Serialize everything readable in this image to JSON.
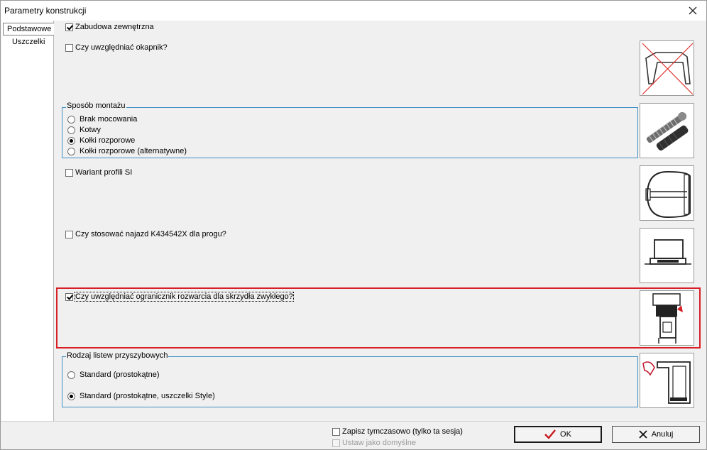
{
  "window": {
    "title": "Parametry konstrukcji"
  },
  "tabs": [
    {
      "label": "Podstawowe",
      "active": true
    },
    {
      "label": "Uszczelki",
      "active": false
    }
  ],
  "options": {
    "zabudowa": {
      "label": "Zabudowa zewnętrzna",
      "checked": true
    },
    "okapnik": {
      "label": "Czy uwzględniać okapnik?",
      "checked": false
    },
    "wariant": {
      "label": "Wariant profili SI",
      "checked": false
    },
    "najazd": {
      "label": "Czy stosować najazd K434542X dla progu?",
      "checked": false
    },
    "ogranicznik": {
      "label": "Czy uwzględniać ogranicznik rozwarcia dla skrzydła zwykłego?",
      "checked": true
    }
  },
  "montaz": {
    "title": "Sposób montażu",
    "items": [
      {
        "label": "Brak mocowania",
        "selected": false
      },
      {
        "label": "Kotwy",
        "selected": false
      },
      {
        "label": "Kołki rozporowe",
        "selected": true
      },
      {
        "label": "Kołki rozporowe (alternatywne)",
        "selected": false
      }
    ]
  },
  "listwy": {
    "title": "Rodzaj listew przyszybowych",
    "items": [
      {
        "label": "Standard (prostokątne)",
        "selected": false
      },
      {
        "label": "Standard (prostokątne, uszczelki Style)",
        "selected": true
      }
    ]
  },
  "footer": {
    "save_temp": {
      "label": "Zapisz tymczasowo (tylko ta sesja)",
      "checked": false
    },
    "set_default": {
      "label": "Ustaw jako domyślne",
      "checked": false,
      "disabled": true
    },
    "ok_label": "OK",
    "cancel_label": "Anuluj"
  },
  "icons": {
    "close": "close-icon",
    "ok": "checkmark-icon",
    "cancel": "x-icon"
  },
  "colors": {
    "highlight": "#d81f26",
    "group_border": "#3c8fc4",
    "ok_check": "#c8181e"
  }
}
